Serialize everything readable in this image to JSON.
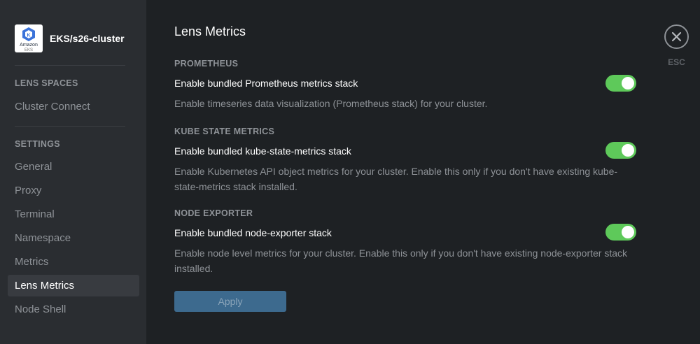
{
  "sidebar": {
    "cluster_name": "EKS/s26-cluster",
    "logo": {
      "line1": "Amazon",
      "line2": "EKS",
      "icon": "eks-logo-icon"
    },
    "sections": [
      {
        "title": "LENS SPACES",
        "items": [
          "Cluster Connect"
        ]
      },
      {
        "title": "SETTINGS",
        "items": [
          "General",
          "Proxy",
          "Terminal",
          "Namespace",
          "Metrics",
          "Lens Metrics",
          "Node Shell"
        ]
      }
    ],
    "active_item": "Lens Metrics"
  },
  "main": {
    "title": "Lens Metrics",
    "groups": [
      {
        "title": "PROMETHEUS",
        "label": "Enable bundled Prometheus metrics stack",
        "enabled": true,
        "hint": "Enable timeseries data visualization (Prometheus stack) for your cluster."
      },
      {
        "title": "KUBE STATE METRICS",
        "label": "Enable bundled kube-state-metrics stack",
        "enabled": true,
        "hint": "Enable Kubernetes API object metrics for your cluster. Enable this only if you don't have existing kube-state-metrics stack installed."
      },
      {
        "title": "NODE EXPORTER",
        "label": "Enable bundled node-exporter stack",
        "enabled": true,
        "hint": "Enable node level metrics for your cluster. Enable this only if you don't have existing node-exporter stack installed."
      }
    ],
    "apply_label": "Apply"
  },
  "close": {
    "icon": "close-icon",
    "label": "ESC"
  },
  "colors": {
    "toggle_on": "#5ec95a",
    "apply_bg": "#3d6a8e",
    "sidebar_bg": "#2a2d31",
    "main_bg": "#1e2124"
  }
}
